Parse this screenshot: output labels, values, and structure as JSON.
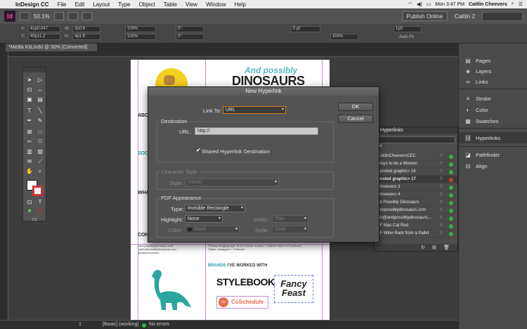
{
  "menubar": {
    "app_name": "InDesign CC",
    "items": [
      "File",
      "Edit",
      "Layout",
      "Type",
      "Object",
      "Table",
      "View",
      "Window",
      "Help"
    ],
    "time": "Mon 3:47 PM",
    "user": "Caitlin Cheevers"
  },
  "appbar": {
    "logo": "Id",
    "zoom": "50.1%",
    "publish": "Publish Online",
    "workspace": "Caitlin 2"
  },
  "control": {
    "x": "41p0.047",
    "y": "40p11.2",
    "w": "2p0.8",
    "h": "4p1.8",
    "scale_x": "100%",
    "scale_y": "100%",
    "rot": "0°",
    "shear": "0°",
    "stroke_w": "0 pt",
    "opacity": "100%",
    "fx": "1p0",
    "auto_fit": "Auto-Fit"
  },
  "document": {
    "tab_label": "*Media KitLindd @ 50% [Converted]"
  },
  "page_content": {
    "title_line1": "And possibly",
    "title_line2": "DINOSAURS",
    "sect_about": "ABOU",
    "sect_social": "SOCI",
    "sect_what": "WHAT",
    "sect_contact": "CONT",
    "contact_left": "www.possiblydinosaurs.com caitlin@possiblydinosaurs.com @caitlincheevers",
    "contact_right": "Primary blogging age: 18-34 Female readers + makers Users of Facebook, Twitter, Instagram + Pinterest",
    "brands_prefix": "BRANDS",
    "brands_rest": " I'VE WORKED WITH",
    "stylebook": "STYLEBOOK",
    "fancy_feast": "Fancy Feast",
    "coschedule": "CoSchedule"
  },
  "status": {
    "page": "1",
    "master": "[Basic] (working)",
    "errors": "No errors"
  },
  "dock": {
    "items": [
      {
        "label": "Pages",
        "icon": "pages-icon",
        "glyph": "▤"
      },
      {
        "label": "Layers",
        "icon": "layers-icon",
        "glyph": "◈"
      },
      {
        "label": "Links",
        "icon": "links-icon",
        "glyph": "∞"
      },
      {
        "label": "Stroke",
        "icon": "stroke-icon",
        "glyph": "≡"
      },
      {
        "label": "Color",
        "icon": "color-icon",
        "glyph": "◐"
      },
      {
        "label": "Swatches",
        "icon": "swatches-icon",
        "glyph": "▦"
      },
      {
        "label": "Hyperlinks",
        "icon": "hyperlinks-icon",
        "glyph": "⛓"
      },
      {
        "label": "Pathfinder",
        "icon": "pathfinder-icon",
        "glyph": "◪"
      },
      {
        "label": "Align",
        "icon": "align-icon",
        "glyph": "⊟"
      }
    ]
  },
  "hyperlinks_panel": {
    "title": "Hyperlinks",
    "url_value": "",
    "url_scope": "ne",
    "rows": [
      {
        "name": "CaitlinCheeversCEC",
        "status": "green",
        "selected": false
      },
      {
        "name": "Ways to be a Women",
        "status": "green",
        "selected": false
      },
      {
        "name": "pposted graphic> 16",
        "status": "green",
        "selected": false
      },
      {
        "name": "posted graphic> 17",
        "status": "red",
        "selected": true
      },
      {
        "name": "linheevers 3",
        "status": "green",
        "selected": false
      },
      {
        "name": "linheevers 4",
        "status": "green",
        "selected": false
      },
      {
        "name": "nd Possibly Dinosaurs",
        "status": "green",
        "selected": false
      },
      {
        "name": "nerpossiblydinosaurs.com",
        "status": "green",
        "selected": false
      },
      {
        "name": "tlin@andpossiblydinosaurs...",
        "status": "green",
        "selected": false
      },
      {
        "name": "FF Mac Cat Red",
        "status": "green",
        "selected": false
      },
      {
        "name": "FF Wine Rack from a Pallet",
        "status": "green",
        "selected": false
      }
    ]
  },
  "dialog": {
    "title": "New Hyperlink",
    "link_to_label": "Link To:",
    "link_to_value": "URL",
    "destination_label": "Destination",
    "url_label": "URL:",
    "url_value": "http://",
    "shared_label": "Shared Hyperlink Destination",
    "char_style_label": "Character Style",
    "style_label": "Style:",
    "style_value": "[None]",
    "pdf_label": "PDF Appearance",
    "type_label": "Type:",
    "type_value": "Invisible Rectangle",
    "highlight_label": "Highlight:",
    "highlight_value": "None",
    "width_label": "Width:",
    "width_value": "Thin",
    "color_label": "Color:",
    "color_value": "Black",
    "style2_label": "Style:",
    "style2_value": "Solid",
    "ok_label": "OK",
    "cancel_label": "Cancel"
  },
  "colors": {
    "accent_orange": "#d5791f",
    "teal": "#55b7bf",
    "status_green": "#2db34a",
    "status_red": "#d23a2a"
  }
}
